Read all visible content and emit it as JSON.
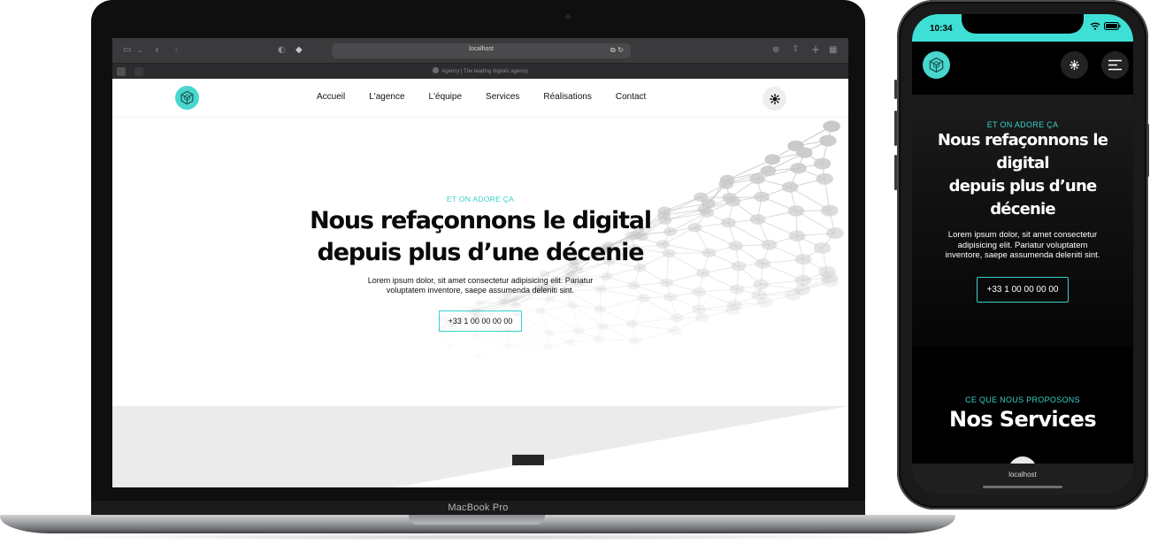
{
  "colors": {
    "accent": "#3ee0d6",
    "dark": "#0a0a0a"
  },
  "laptop": {
    "model_label": "MacBook Pro",
    "browser": {
      "url": "localhost",
      "tab_title": "Agency | The leading digitals agency",
      "icons": [
        "sidebar-icon",
        "back-icon",
        "forward-icon",
        "shield-icon",
        "layers-icon",
        "translate-icon",
        "reload-icon",
        "download-icon",
        "share-icon",
        "new-tab-icon",
        "tab-overview-icon"
      ]
    },
    "site": {
      "nav": {
        "links": [
          "Accueil",
          "L'agence",
          "L'équipe",
          "Services",
          "Réalisations",
          "Contact"
        ]
      },
      "hero": {
        "eyebrow": "ET ON ADORE ÇA",
        "title_line1": "Nous refaçonnons le digital",
        "title_line2": "depuis plus d’une décenie",
        "text_line1": "Lorem ipsum dolor, sit amet consectetur adipisicing elit. Pariatur",
        "text_line2": "voluptatem inventore, saepe assumenda deleniti sint.",
        "cta": "+33 1 00 00 00 00"
      }
    }
  },
  "phone": {
    "status_time": "10:34",
    "hero": {
      "eyebrow": "ET ON ADORE ÇA",
      "title_line1": "Nous refaçonnons le",
      "title_line2": "digital",
      "title_line3": "depuis plus d’une",
      "title_line4": "décenie",
      "text_line1": "Lorem ipsum dolor, sit amet consectetur",
      "text_line2": "adipisicing elit. Pariatur voluptatem",
      "text_line3": "inventore, saepe assumenda deleniti sint.",
      "cta": "+33 1 00 00 00 00"
    },
    "services": {
      "eyebrow": "CE QUE NOUS PROPOSONS",
      "title": "Nos Services"
    },
    "url": "localhost"
  }
}
